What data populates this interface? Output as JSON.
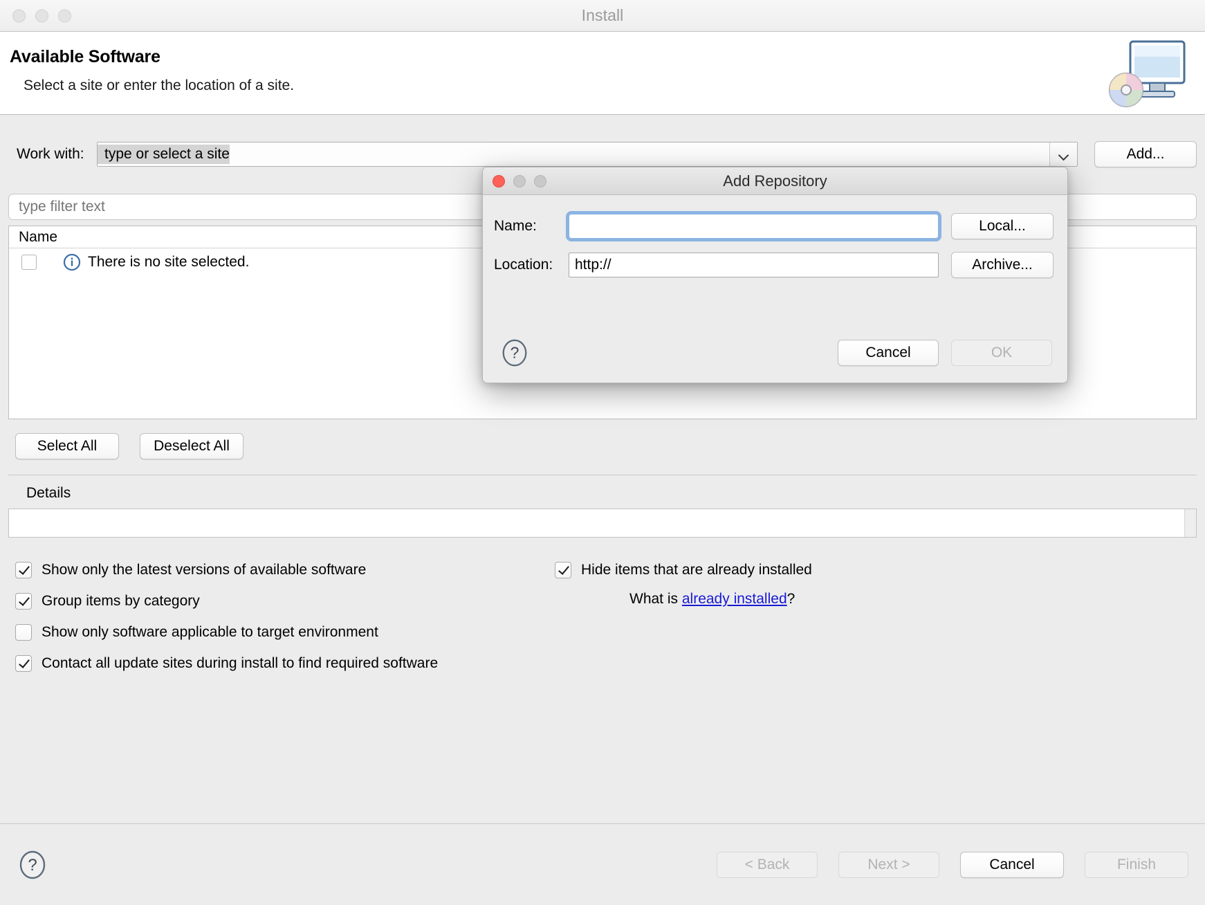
{
  "window": {
    "title": "Install",
    "traffic_lights": [
      "close-button",
      "minimize-button",
      "zoom-button"
    ]
  },
  "banner": {
    "heading": "Available Software",
    "subheading": "Select a site or enter the location of a site.",
    "icon": "install-monitor-cd-icon"
  },
  "work_with": {
    "label": "Work with:",
    "value": "type or select a site",
    "dropdown_icon": "chevron-down-icon",
    "add_label": "Add..."
  },
  "filter": {
    "placeholder": "type filter text",
    "value": ""
  },
  "tree": {
    "column_header": "Name",
    "rows": [
      {
        "icon": "info-icon",
        "label": "There is no site selected.",
        "checked": false
      }
    ]
  },
  "selection_buttons": {
    "select_all": "Select All",
    "deselect_all": "Deselect All"
  },
  "details": {
    "label": "Details",
    "value": ""
  },
  "options": {
    "left": [
      {
        "label": "Show only the latest versions of available software",
        "checked": true
      },
      {
        "label": "Group items by category",
        "checked": true
      },
      {
        "label": "Show only software applicable to target environment",
        "checked": false
      },
      {
        "label": "Contact all update sites during install to find required software",
        "checked": true
      }
    ],
    "right": [
      {
        "label": "Hide items that are already installed",
        "checked": true
      }
    ],
    "what_is_prefix": "What is ",
    "what_is_link": "already installed",
    "what_is_suffix": "?"
  },
  "footer": {
    "help_icon": "help-question-icon",
    "back": "< Back",
    "next": "Next >",
    "cancel": "Cancel",
    "finish": "Finish"
  },
  "dialog": {
    "title": "Add Repository",
    "traffic_lights": [
      "close-button",
      "minimize-button",
      "zoom-button"
    ],
    "name_label": "Name:",
    "name_value": "",
    "location_label": "Location:",
    "location_value": "http://",
    "local_label": "Local...",
    "archive_label": "Archive...",
    "help_icon": "help-question-icon",
    "cancel_label": "Cancel",
    "ok_label": "OK"
  },
  "colors": {
    "focus_ring": "#8cb4e2",
    "link": "#1919d6",
    "close_red": "#ff6159",
    "window_bg": "#ececec"
  }
}
